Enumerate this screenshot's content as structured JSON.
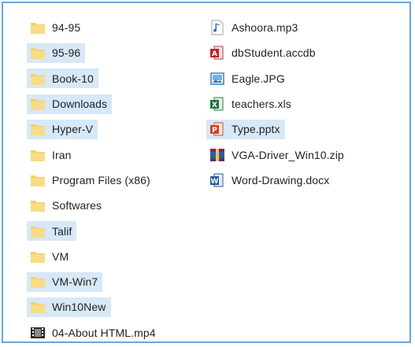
{
  "explorer": {
    "folders": [
      {
        "label": "94-95",
        "icon": "folder-icon",
        "selected": false
      },
      {
        "label": "95-96",
        "icon": "folder-icon",
        "selected": true
      },
      {
        "label": "Book-10",
        "icon": "folder-icon",
        "selected": true
      },
      {
        "label": "Downloads",
        "icon": "folder-icon",
        "selected": true
      },
      {
        "label": "Hyper-V",
        "icon": "folder-icon",
        "selected": true
      },
      {
        "label": "Iran",
        "icon": "folder-icon",
        "selected": false
      },
      {
        "label": "Program Files (x86)",
        "icon": "folder-icon",
        "selected": false
      },
      {
        "label": "Softwares",
        "icon": "folder-icon",
        "selected": false
      },
      {
        "label": "Talif",
        "icon": "folder-icon",
        "selected": true
      },
      {
        "label": "VM",
        "icon": "folder-icon",
        "selected": false
      },
      {
        "label": "VM-Win7",
        "icon": "folder-icon",
        "selected": true
      },
      {
        "label": "Win10New",
        "icon": "folder-icon",
        "selected": true
      },
      {
        "label": "04-About HTML.mp4",
        "icon": "video-file-icon",
        "selected": false
      }
    ],
    "files": [
      {
        "label": "Ashoora.mp3",
        "icon": "audio-file-icon",
        "selected": false
      },
      {
        "label": "dbStudent.accdb",
        "icon": "access-file-icon",
        "selected": false
      },
      {
        "label": "Eagle.JPG",
        "icon": "image-file-icon",
        "selected": false
      },
      {
        "label": "teachers.xls",
        "icon": "excel-file-icon",
        "selected": false
      },
      {
        "label": "Type.pptx",
        "icon": "powerpoint-file-icon",
        "selected": true
      },
      {
        "label": "VGA-Driver_Win10.zip",
        "icon": "zip-file-icon",
        "selected": false
      },
      {
        "label": "Word-Drawing.docx",
        "icon": "word-file-icon",
        "selected": false
      }
    ],
    "colors": {
      "frame_border": "#6aa5d9",
      "selection": "#d7e8f7",
      "folder": "#f4cf6a"
    }
  }
}
